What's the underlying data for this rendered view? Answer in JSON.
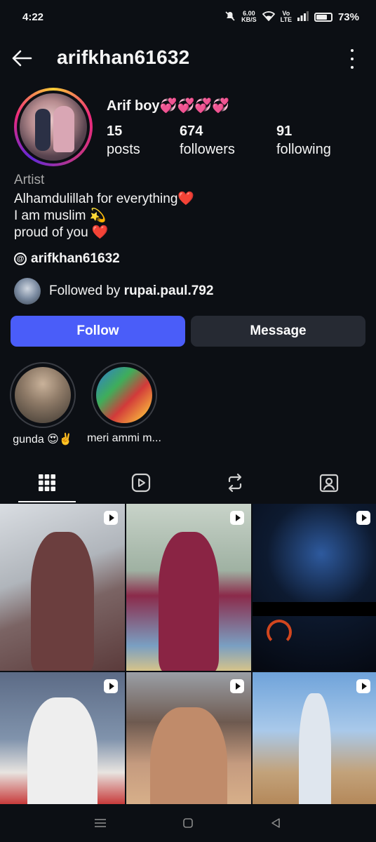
{
  "status_bar": {
    "time": "4:22",
    "net_speed_top": "6.00",
    "net_speed_unit": "KB/S",
    "volte_top": "Vo",
    "volte_bottom": "LTE",
    "battery": "73%"
  },
  "header": {
    "username": "arifkhan61632"
  },
  "profile": {
    "display_name": "Arif boy💞💞💞💞",
    "stats": [
      {
        "value": "15",
        "label": "posts"
      },
      {
        "value": "674",
        "label": "followers"
      },
      {
        "value": "91",
        "label": "following"
      }
    ],
    "category": "Artist",
    "bio_lines": [
      "Alhamdulillah for everything❤️",
      "I am muslim 💫",
      "proud of you ❤️"
    ],
    "threads_handle": "arifkhan61632",
    "followed_by_prefix": "Followed by",
    "followed_by_user": "rupai.paul.792"
  },
  "actions": {
    "follow_label": "Follow",
    "message_label": "Message"
  },
  "highlights": [
    {
      "caption": "gunda 😍✌️"
    },
    {
      "caption": "meri ammi m..."
    }
  ],
  "tabs": [
    {
      "name": "posts-grid",
      "active": true
    },
    {
      "name": "reels",
      "active": false
    },
    {
      "name": "reposts",
      "active": false
    },
    {
      "name": "tagged",
      "active": false
    }
  ],
  "grid": [
    {
      "type": "reel"
    },
    {
      "type": "reel"
    },
    {
      "type": "reel"
    },
    {
      "type": "reel"
    },
    {
      "type": "reel"
    },
    {
      "type": "reel"
    }
  ],
  "colors": {
    "background": "#0c0f14",
    "follow_button": "#4a5df9",
    "message_button": "#262a33",
    "muted_text": "#a8a8a8"
  }
}
